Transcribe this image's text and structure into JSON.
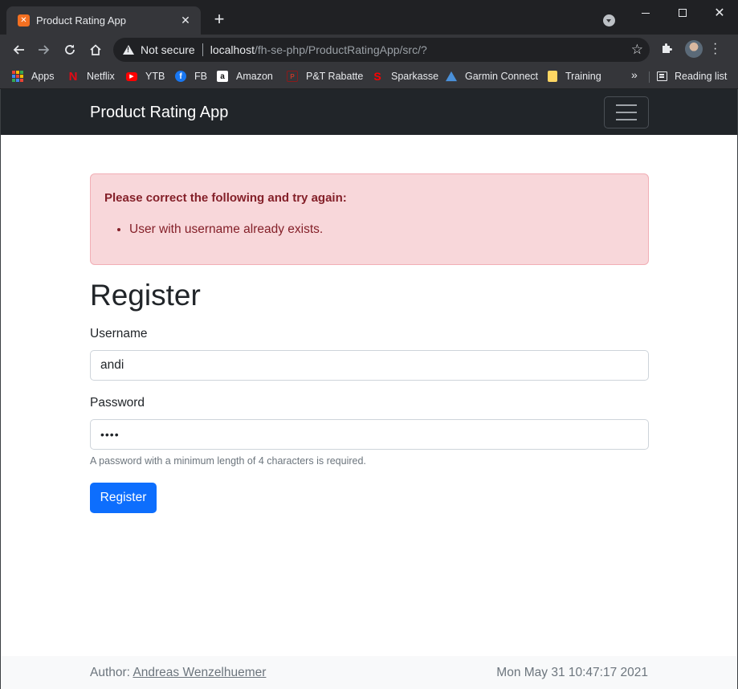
{
  "browser": {
    "tab_title": "Product Rating App",
    "tab_favicon_icon": "xampp-icon",
    "new_tab_label": "+",
    "security_label": "Not secure",
    "url_host": "localhost",
    "url_path": "/fh-se-php/ProductRatingApp/src/?",
    "bookmarks": [
      {
        "label": "Apps",
        "icon": "apps-grid-icon"
      },
      {
        "label": "Netflix",
        "icon": "netflix-icon",
        "color": "#e50914"
      },
      {
        "label": "YTB",
        "icon": "youtube-icon",
        "color": "#ff0000"
      },
      {
        "label": "FB",
        "icon": "facebook-icon",
        "color": "#1877f2"
      },
      {
        "label": "Amazon",
        "icon": "amazon-icon",
        "color": "#ffffff"
      },
      {
        "label": "P&T Rabatte",
        "icon": "pt-icon",
        "color": "#c0392b"
      },
      {
        "label": "Sparkasse",
        "icon": "sparkasse-icon",
        "color": "#ff0000"
      },
      {
        "label": "Garmin Connect",
        "icon": "garmin-icon",
        "color": "#4a90d9"
      },
      {
        "label": "Training",
        "icon": "folder-icon",
        "color": "#fdd663"
      }
    ],
    "bookmarks_overflow": "»",
    "reading_list_label": "Reading list"
  },
  "app": {
    "brand": "Product Rating App"
  },
  "alert": {
    "heading": "Please correct the following and try again:",
    "errors": [
      "User with username already exists."
    ]
  },
  "form": {
    "title": "Register",
    "username_label": "Username",
    "username_value": "andi",
    "password_label": "Password",
    "password_value": "••••",
    "password_help": "A password with a minimum length of 4 characters is required.",
    "submit_label": "Register"
  },
  "footer": {
    "author_prefix": "Author: ",
    "author_name": "Andreas Wenzelhuemer",
    "timestamp": "Mon May 31 10:47:17 2021"
  },
  "colors": {
    "navbar": "#212529",
    "primary": "#0d6efd",
    "alert_bg": "#f8d7da",
    "alert_text": "#842029"
  }
}
